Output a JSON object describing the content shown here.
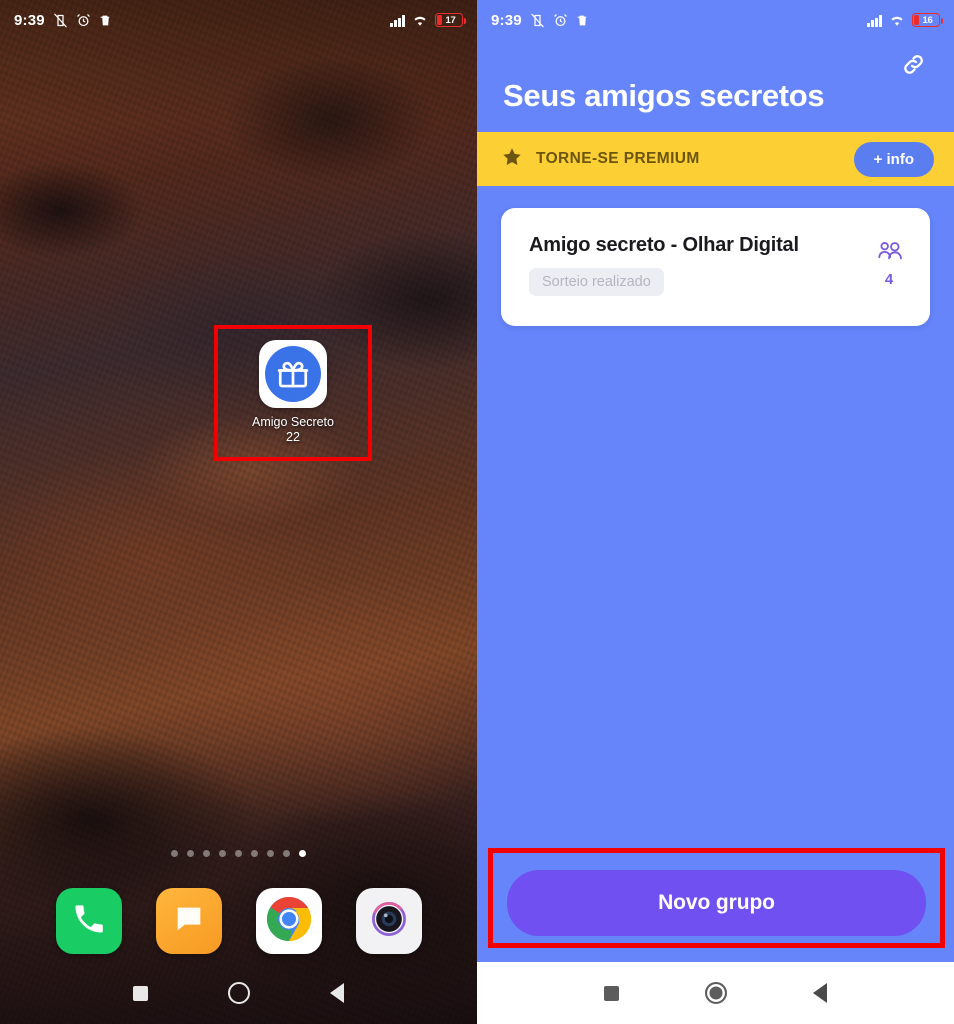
{
  "left_phone": {
    "statusbar": {
      "time": "9:39",
      "icons": [
        "vibrate-off-icon",
        "alarm-icon",
        "trash-icon"
      ],
      "signal": "signal-bars-icon",
      "wifi": "wifi-icon",
      "battery_percent": "17"
    },
    "app_shortcut": {
      "label_line1": "Amigo Secreto",
      "label_line2": "22",
      "icon": "gift-icon",
      "highlighted": true
    },
    "page_dots": {
      "count": 9,
      "active_index": 8
    },
    "dock": [
      {
        "name": "phone",
        "label": "Phone",
        "icon": "phone-icon"
      },
      {
        "name": "messages",
        "label": "Messages",
        "icon": "message-icon"
      },
      {
        "name": "chrome",
        "label": "Chrome",
        "icon": "chrome-icon"
      },
      {
        "name": "camera",
        "label": "Camera",
        "icon": "camera-icon"
      }
    ],
    "navbar": [
      "recents-square-icon",
      "home-circle-icon",
      "back-triangle-icon"
    ]
  },
  "right_phone": {
    "statusbar": {
      "time": "9:39",
      "icons": [
        "vibrate-off-icon",
        "alarm-icon",
        "trash-icon"
      ],
      "signal": "signal-bars-icon",
      "wifi": "wifi-icon",
      "battery_percent": "16"
    },
    "header": {
      "title": "Seus amigos secretos",
      "link_icon": "link-icon"
    },
    "premium_banner": {
      "star_icon": "star-icon",
      "label": "TORNE-SE PREMIUM",
      "button_label": "+ info"
    },
    "groups": [
      {
        "name": "Amigo secreto - Olhar Digital",
        "status_badge": "Sorteio realizado",
        "members_icon": "people-icon",
        "members_count": "4"
      }
    ],
    "cta": {
      "label": "Novo grupo",
      "highlighted": true
    },
    "navbar": [
      "recents-square-icon",
      "home-circle-icon",
      "back-triangle-icon"
    ]
  },
  "colors": {
    "app_blue": "#6685fa",
    "premium_yellow": "#fcd034",
    "cta_purple": "#7050f0",
    "info_button_blue": "#5a7df0",
    "highlight_red": "#f20000",
    "member_purple": "#7a5bdd",
    "icon_blue": "#3a72e8"
  }
}
